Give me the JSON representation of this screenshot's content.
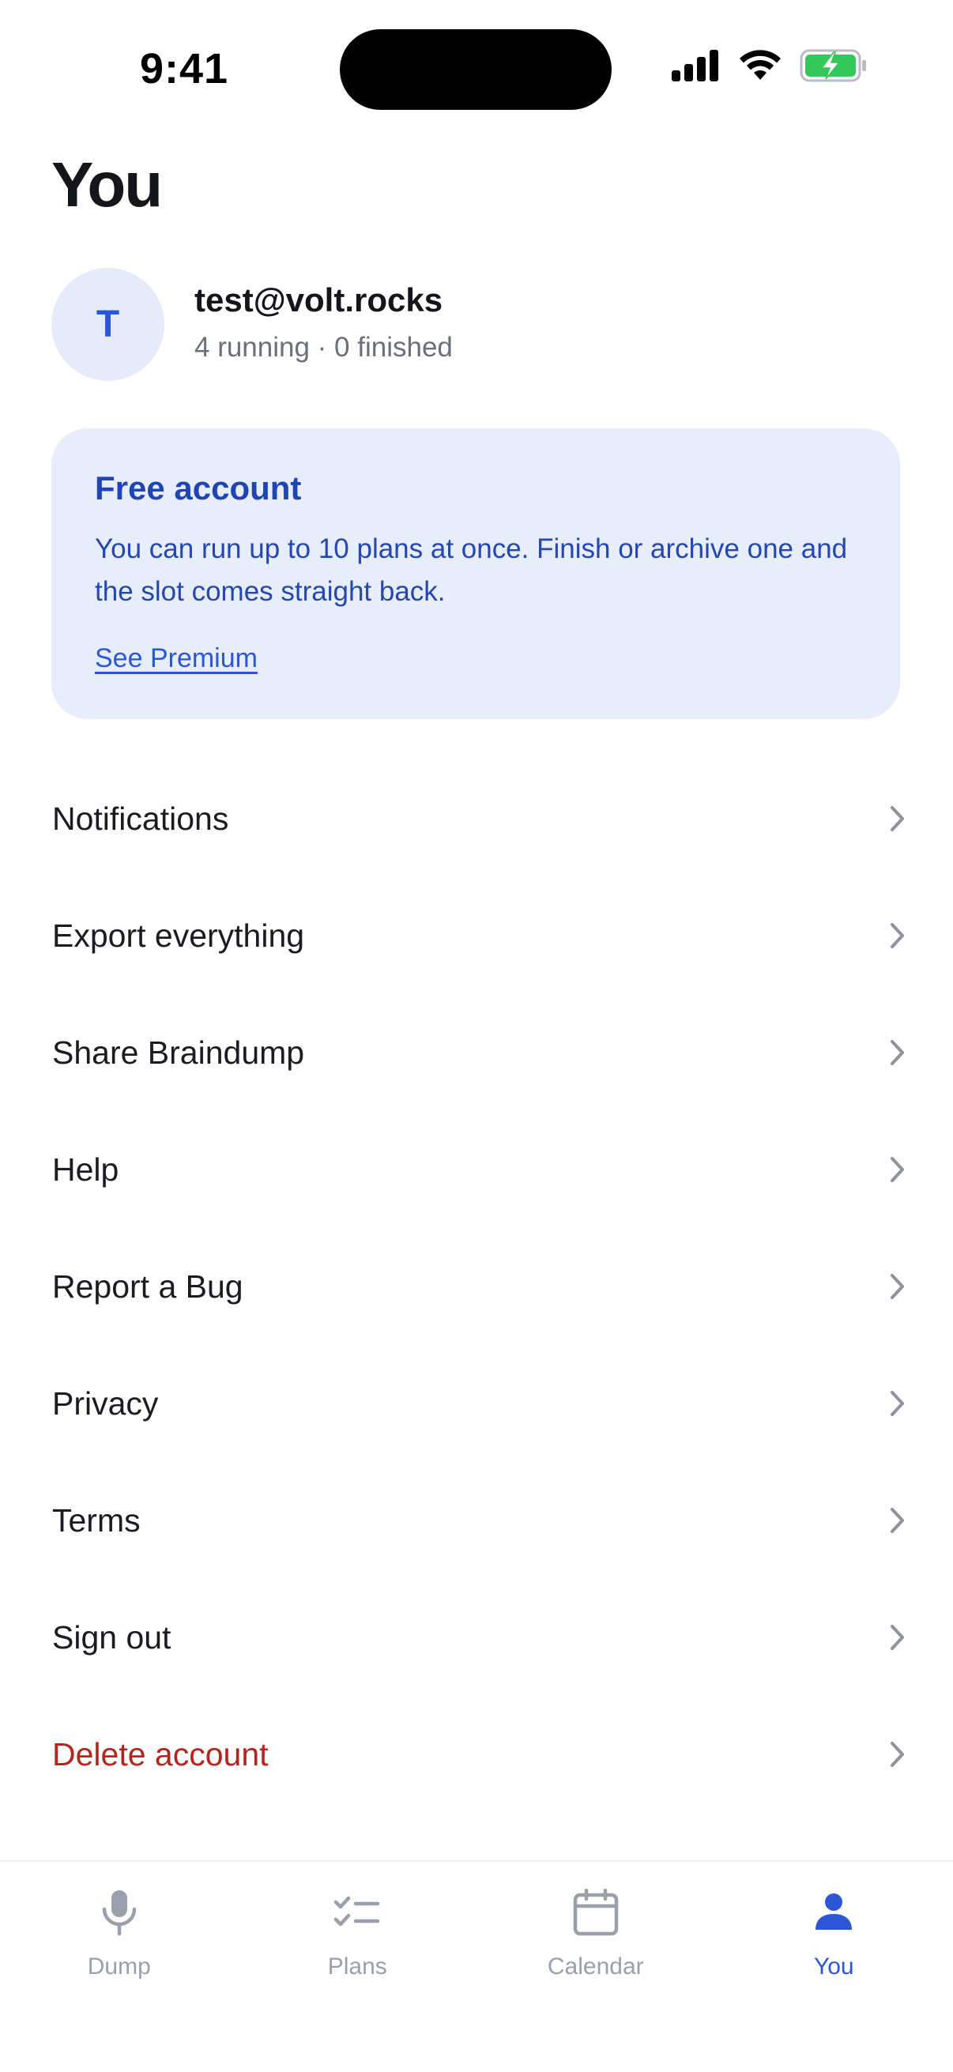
{
  "status_bar": {
    "time": "9:41"
  },
  "header": {
    "title": "You"
  },
  "profile": {
    "avatar_letter": "T",
    "email": "test@volt.rocks",
    "stats": "4 running · 0 finished"
  },
  "plan_card": {
    "title": "Free account",
    "body": "You can run up to 10 plans at once. Finish or archive one and the slot comes straight back.",
    "link": "See Premium"
  },
  "menu": {
    "items": [
      {
        "label": "Notifications"
      },
      {
        "label": "Export everything"
      },
      {
        "label": "Share Braindump"
      },
      {
        "label": "Help"
      },
      {
        "label": "Report a Bug"
      },
      {
        "label": "Privacy"
      },
      {
        "label": "Terms"
      },
      {
        "label": "Sign out"
      },
      {
        "label": "Delete account"
      }
    ]
  },
  "tab_bar": {
    "tabs": [
      {
        "label": "Dump",
        "icon": "microphone-icon"
      },
      {
        "label": "Plans",
        "icon": "checklist-icon"
      },
      {
        "label": "Calendar",
        "icon": "calendar-icon"
      },
      {
        "label": "You",
        "icon": "person-icon",
        "active": true
      }
    ]
  },
  "colors": {
    "accent": "#2b56d6",
    "card_background": "#e8edfb",
    "danger": "#b3261e",
    "inactive_tab": "#9aa0ab"
  }
}
